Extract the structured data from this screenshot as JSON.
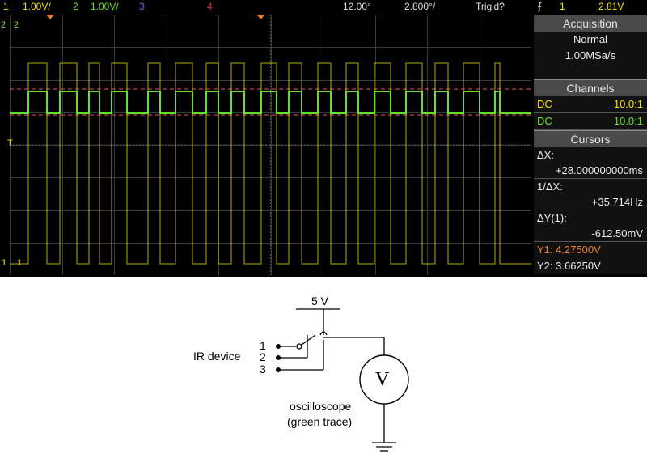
{
  "topbar": {
    "ch1_num": "1",
    "ch1_scale": "1.00V/",
    "ch2_num": "2",
    "ch2_scale": "1.00V/",
    "ch3_num": "3",
    "ch4_num": "4",
    "timebase": "12.00°",
    "delay": "2.800°/",
    "trigger_status": "Trig'd?",
    "trig_source": "1",
    "trig_level": "2.81V"
  },
  "markers": {
    "ch2_left": "2",
    "ch2_right": "2",
    "trig_marker": "T",
    "ch1_left": "1",
    "ch1_right": "1"
  },
  "colors": {
    "ch1": "#f4e400",
    "ch2": "#66e12a",
    "cursor": "#e05a5a",
    "grid": "#3a3a3a",
    "trigger": "#f08030"
  },
  "panel": {
    "acquisition": {
      "title": "Acquisition",
      "mode": "Normal",
      "rate": "1.00MSa/s"
    },
    "channels": {
      "title": "Channels",
      "rows": [
        {
          "coupling": "DC",
          "probe": "10.0:1"
        },
        {
          "coupling": "DC",
          "probe": "10.0:1"
        }
      ]
    },
    "cursors": {
      "title": "Cursors",
      "dx_label": "ΔX:",
      "dx_value": "+28.000000000ms",
      "inv_dx_label": "1/ΔX:",
      "inv_dx_value": "+35.714Hz",
      "dy_label": "ΔY(1):",
      "dy_value": "-612.50mV",
      "y1": "Y1: 4.27500V",
      "y2": "Y2: 3.66250V"
    }
  },
  "circuit": {
    "supply_label": "5 V",
    "device_label": "IR device",
    "pin1": "1",
    "pin2": "2",
    "pin3": "3",
    "meter_symbol": "V",
    "scope_label_line1": "oscilloscope",
    "scope_label_line2": "(green trace)"
  },
  "waveform": {
    "pulse_edges": [
      0.035,
      0.072,
      0.096,
      0.128,
      0.152,
      0.172,
      0.196,
      0.225,
      0.265,
      0.288,
      0.318,
      0.35,
      0.376,
      0.4,
      0.425,
      0.45,
      0.482,
      0.512,
      0.535,
      0.56,
      0.59,
      0.615,
      0.645,
      0.668,
      0.7,
      0.73,
      0.76,
      0.79,
      0.815,
      0.84,
      0.87,
      0.9,
      0.93,
      0.94
    ]
  }
}
